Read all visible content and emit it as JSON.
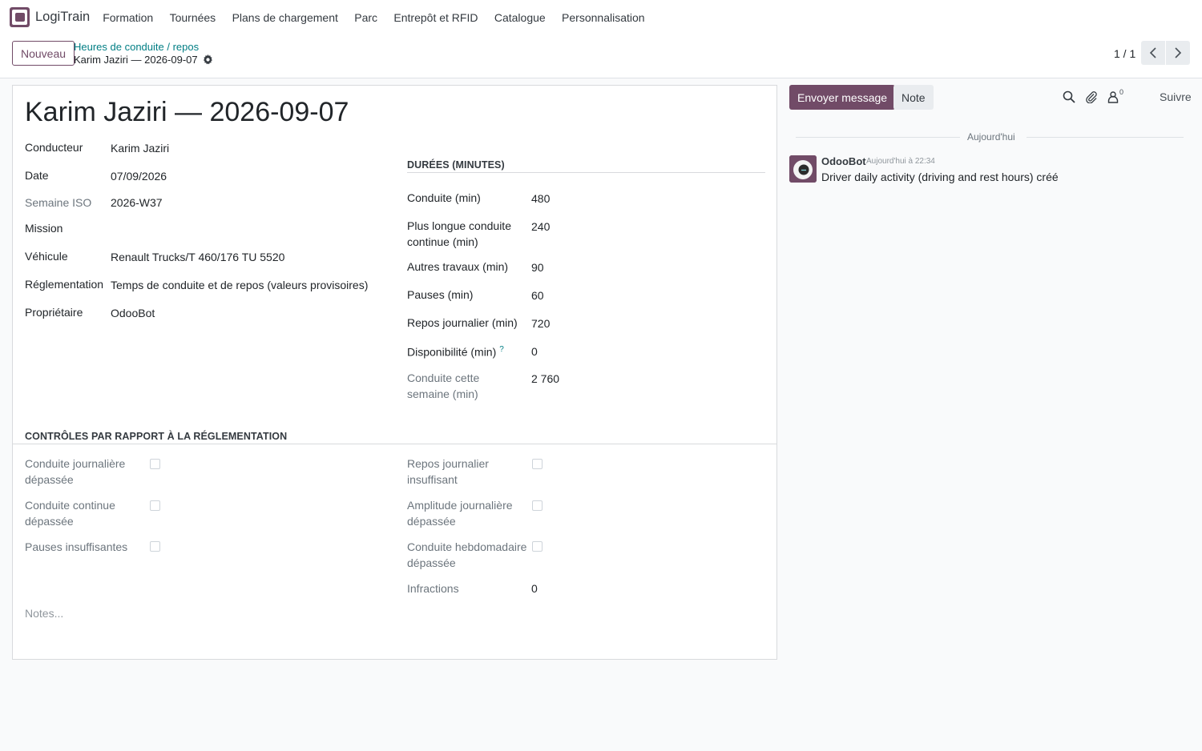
{
  "navbar": {
    "app_name": "LogiTrain",
    "menu": [
      "Formation",
      "Tournées",
      "Plans de chargement",
      "Parc",
      "Entrepôt et RFID",
      "Catalogue",
      "Personnalisation"
    ]
  },
  "control": {
    "new_label": "Nouveau",
    "breadcrumb_parent": "Heures de conduite / repos",
    "breadcrumb_current": "Karim Jaziri — 2026-09-07",
    "pager": "1 / 1"
  },
  "form": {
    "title": "Karim Jaziri — 2026-09-07",
    "left": [
      {
        "label": "Conducteur",
        "value": "Karim Jaziri"
      },
      {
        "label": "Date",
        "value": "07/09/2026"
      },
      {
        "label": "Semaine ISO",
        "value": "2026-W37"
      },
      {
        "label": "Mission",
        "value": ""
      },
      {
        "label": "Véhicule",
        "value": "Renault Trucks/T 460/176 TU 5520"
      },
      {
        "label": "Réglementation",
        "value": "Temps de conduite et de repos (valeurs provisoires)"
      },
      {
        "label": "Propriétaire",
        "value": "OdooBot"
      }
    ],
    "durations_title": "DURÉES (MINUTES)",
    "durations": [
      {
        "label": "Conduite (min)",
        "value": "480"
      },
      {
        "label": "Plus longue conduite continue (min)",
        "value": "240"
      },
      {
        "label": "Autres travaux (min)",
        "value": "90"
      },
      {
        "label": "Pauses (min)",
        "value": "60"
      },
      {
        "label": "Repos journalier (min)",
        "value": "720"
      },
      {
        "label": "Disponibilité (min)",
        "value": "0",
        "help": "?"
      },
      {
        "label": "Conduite cette semaine (min)",
        "value": "2 760"
      }
    ],
    "checks_title": "CONTRÔLES PAR RAPPORT À LA RÉGLEMENTATION",
    "checks_left": [
      {
        "label": "Conduite journalière dépassée",
        "checked": false
      },
      {
        "label": "Conduite continue dépassée",
        "checked": false
      },
      {
        "label": "Pauses insuffisantes",
        "checked": false
      }
    ],
    "checks_right": [
      {
        "label": "Repos journalier insuffisant",
        "checked": false
      },
      {
        "label": "Amplitude journalière dépassée",
        "checked": false
      },
      {
        "label": "Conduite hebdomadaire dépassée",
        "checked": false
      }
    ],
    "infractions": {
      "label": "Infractions",
      "value": "0"
    },
    "notes_placeholder": "Notes..."
  },
  "chatter": {
    "send_label": "Envoyer message",
    "note_label": "Note",
    "follower_count": "0",
    "follow_label": "Suivre",
    "day_label": "Aujourd'hui",
    "message": {
      "author": "OdooBot",
      "date": "Aujourd'hui à 22:34",
      "body": "Driver daily activity (driving and rest hours) créé"
    }
  },
  "colors": {
    "brand": "#714b67",
    "link": "#017e84"
  }
}
